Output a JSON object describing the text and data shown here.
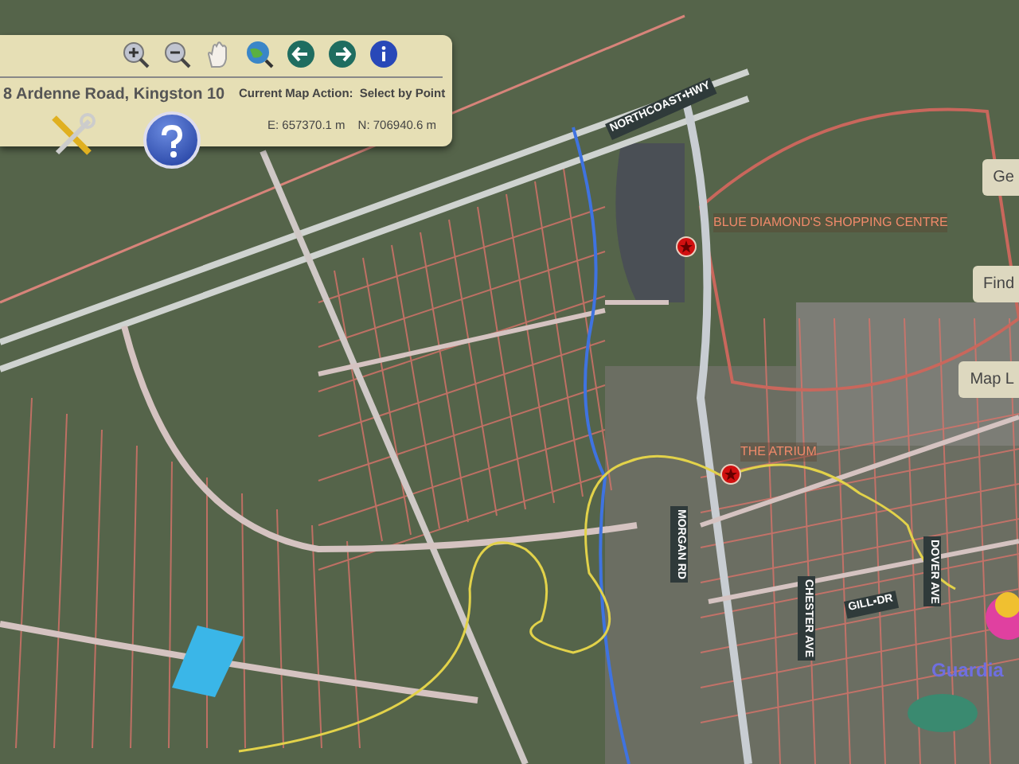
{
  "toolbar": {
    "address": "8 Ardenne Road, Kingston 10",
    "map_action_label": "Current Map Action:",
    "map_action": "Select by Point",
    "easting": "E: 657370.1 m",
    "northing": "N: 706940.6 m"
  },
  "side_buttons": [
    {
      "label": "Ge"
    },
    {
      "label": "Find"
    },
    {
      "label": "Map L"
    }
  ],
  "road_labels": [
    {
      "text": "NORTHCOAST▪HWY"
    },
    {
      "text": "MORGAN RD"
    },
    {
      "text": "GILL▪DR"
    },
    {
      "text": "CHESTER AVE"
    },
    {
      "text": "DOVER AVE"
    }
  ],
  "places": [
    {
      "name": "BLUE DIAMOND'S SHOPPING CENTRE"
    },
    {
      "name": "THE ATRIUM"
    }
  ],
  "logo": {
    "text": "Guardia"
  }
}
